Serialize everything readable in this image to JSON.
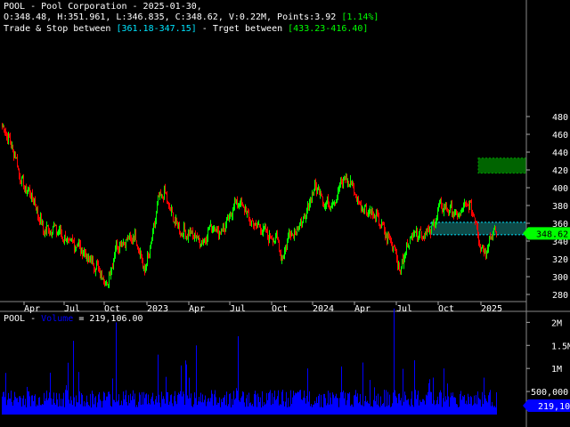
{
  "header": {
    "ticker": "POOL",
    "company": "Pool Corporation",
    "date": "2025-01-30,",
    "ohlc": "O:348.48, H:351.961, L:346.835, C:348.62, V:0.22M, Points:3.92",
    "change_pct": "[1.14%]",
    "trade_stop_label": "Trade & Stop between",
    "trade_stop_range": "[361.18-347.15]",
    "target_label": "- Trget between",
    "target_range": "[433.23-416.40]"
  },
  "volume_header": {
    "ticker": "POOL",
    "label": "Volume",
    "value": "= 219,106.00"
  },
  "colors": {
    "up": "#00ff00",
    "down": "#ff0000",
    "volume": "#0000ff",
    "trade_zone": "#0d4a48",
    "target_zone": "#006400",
    "price_tag": "#00ff00",
    "volume_tag": "#0000ff",
    "cyan": "#00e5ff",
    "green_text": "#00ff00"
  },
  "chart_data": [
    {
      "type": "candlestick",
      "title": "",
      "ylim": [
        270,
        495
      ],
      "y_ticks": [
        280,
        300,
        320,
        340,
        360,
        380,
        400,
        420,
        440,
        460,
        480
      ],
      "x_ticks": [
        "Apr",
        "Jul",
        "Oct",
        "2023",
        "Apr",
        "Jul",
        "Oct",
        "2024",
        "Apr",
        "Jul",
        "Oct",
        "2025"
      ],
      "last_price": "348.62",
      "trade_zone": [
        347.15,
        361.18
      ],
      "target_zone": [
        416.4,
        433.23
      ],
      "close_anchors": [
        [
          0,
          470
        ],
        [
          12,
          445
        ],
        [
          22,
          405
        ],
        [
          34,
          390
        ],
        [
          46,
          352
        ],
        [
          60,
          355
        ],
        [
          72,
          340
        ],
        [
          85,
          335
        ],
        [
          97,
          320
        ],
        [
          108,
          308
        ],
        [
          118,
          290
        ],
        [
          128,
          335
        ],
        [
          138,
          340
        ],
        [
          150,
          345
        ],
        [
          160,
          305
        ],
        [
          168,
          340
        ],
        [
          175,
          385
        ],
        [
          182,
          395
        ],
        [
          190,
          370
        ],
        [
          202,
          350
        ],
        [
          213,
          348
        ],
        [
          225,
          338
        ],
        [
          235,
          358
        ],
        [
          245,
          350
        ],
        [
          253,
          360
        ],
        [
          262,
          385
        ],
        [
          270,
          380
        ],
        [
          280,
          360
        ],
        [
          290,
          355
        ],
        [
          300,
          345
        ],
        [
          308,
          343
        ],
        [
          315,
          320
        ],
        [
          322,
          348
        ],
        [
          330,
          352
        ],
        [
          340,
          365
        ],
        [
          348,
          395
        ],
        [
          355,
          400
        ],
        [
          363,
          380
        ],
        [
          373,
          385
        ],
        [
          383,
          410
        ],
        [
          392,
          405
        ],
        [
          400,
          382
        ],
        [
          410,
          375
        ],
        [
          420,
          368
        ],
        [
          430,
          348
        ],
        [
          440,
          335
        ],
        [
          447,
          305
        ],
        [
          454,
          332
        ],
        [
          462,
          352
        ],
        [
          472,
          348
        ],
        [
          482,
          352
        ],
        [
          492,
          380
        ],
        [
          502,
          375
        ],
        [
          512,
          368
        ],
        [
          522,
          382
        ],
        [
          530,
          370
        ],
        [
          537,
          335
        ],
        [
          543,
          328
        ],
        [
          550,
          350
        ],
        [
          554,
          348.62
        ]
      ]
    },
    {
      "type": "bar",
      "title": "Volume",
      "ylim": [
        0,
        2200000
      ],
      "y_ticks": [
        500000,
        1000000,
        1500000,
        2000000
      ],
      "y_tick_labels": [
        "500,000",
        "1M",
        "1.5M",
        "2M"
      ],
      "baseline": 300000,
      "spikes": [
        [
          28,
          600000
        ],
        [
          80,
          1600000
        ],
        [
          128,
          2000000
        ],
        [
          175,
          1300000
        ],
        [
          218,
          1500000
        ],
        [
          265,
          1700000
        ],
        [
          343,
          1000000
        ],
        [
          440,
          2300000
        ],
        [
          496,
          1000000
        ],
        [
          541,
          800000
        ]
      ],
      "last_value": "219,10"
    }
  ]
}
